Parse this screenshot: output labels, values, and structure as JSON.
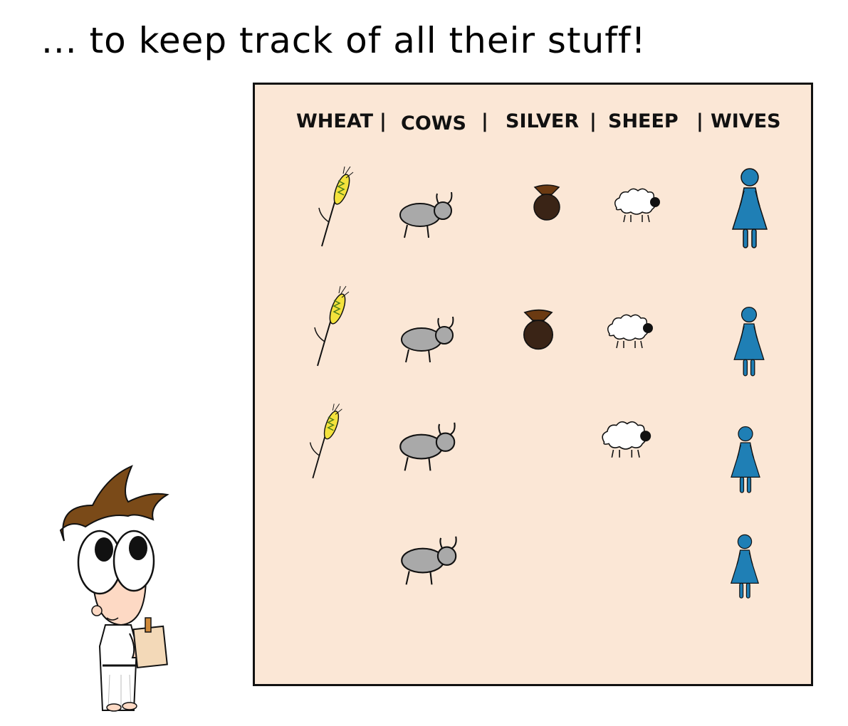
{
  "caption": "... to keep track of all their stuff!",
  "table": {
    "columns": [
      "WHEAT",
      "COWS",
      "SILVER",
      "SHEEP",
      "WIVES"
    ],
    "separator": "|",
    "counts": {
      "WHEAT": 3,
      "COWS": 4,
      "SILVER": 2,
      "SHEEP": 3,
      "WIVES": 4
    },
    "icons": {
      "WHEAT": "wheat-icon",
      "COWS": "cow-icon",
      "SILVER": "silver-bag-icon",
      "SHEEP": "sheep-icon",
      "WIVES": "woman-icon"
    }
  },
  "colors": {
    "board_bg": "#fbe7d6",
    "wheat": "#f4e23c",
    "cow": "#a9a9a9",
    "silver_bag": "#3a2416",
    "wife": "#1f7fb5",
    "hair": "#7a4a18"
  }
}
